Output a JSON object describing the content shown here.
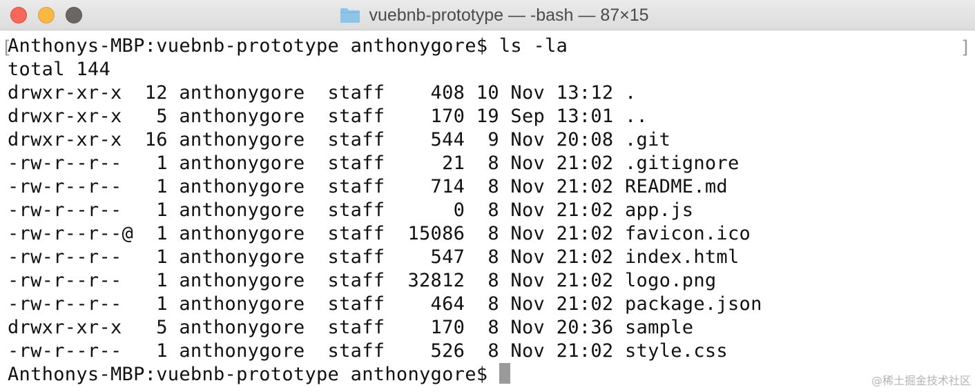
{
  "window": {
    "title": "vuebnb-prototype — -bash — 87×15"
  },
  "terminal": {
    "lines": [
      "Anthonys-MBP:vuebnb-prototype anthonygore$ ls -la",
      "total 144",
      "drwxr-xr-x  12 anthonygore  staff    408 10 Nov 13:12 .",
      "drwxr-xr-x   5 anthonygore  staff    170 19 Sep 13:01 ..",
      "drwxr-xr-x  16 anthonygore  staff    544  9 Nov 20:08 .git",
      "-rw-r--r--   1 anthonygore  staff     21  8 Nov 21:02 .gitignore",
      "-rw-r--r--   1 anthonygore  staff    714  8 Nov 21:02 README.md",
      "-rw-r--r--   1 anthonygore  staff      0  8 Nov 21:02 app.js",
      "-rw-r--r--@  1 anthonygore  staff  15086  8 Nov 21:02 favicon.ico",
      "-rw-r--r--   1 anthonygore  staff    547  8 Nov 21:02 index.html",
      "-rw-r--r--   1 anthonygore  staff  32812  8 Nov 21:02 logo.png",
      "-rw-r--r--   1 anthonygore  staff    464  8 Nov 21:02 package.json",
      "drwxr-xr-x   5 anthonygore  staff    170  8 Nov 20:36 sample",
      "-rw-r--r--   1 anthonygore  staff    526  8 Nov 21:02 style.css"
    ],
    "prompt": "Anthonys-MBP:vuebnb-prototype anthonygore$ "
  },
  "watermark": "@稀土掘金技术社区",
  "icons": {
    "title_icon": "folder-icon",
    "left_bracket": "[",
    "right_bracket": "]"
  },
  "colors": {
    "close": "#f7675c",
    "minimize": "#f9b843",
    "zoom": "#6b6661",
    "folder": "#8fc3e8",
    "text": "#111111",
    "cursor": "#9a9a9a"
  }
}
